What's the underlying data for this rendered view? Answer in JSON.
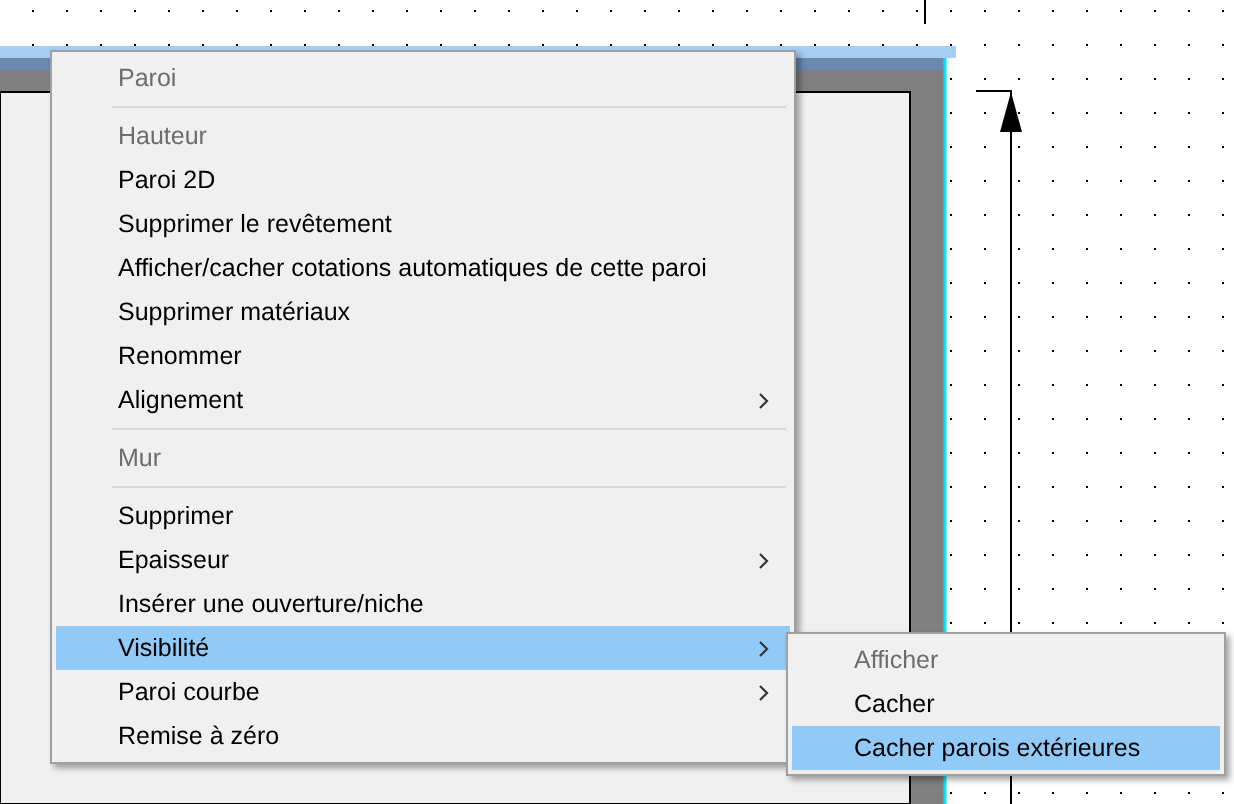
{
  "context_menu": {
    "items": [
      {
        "kind": "item",
        "label": "Paroi",
        "disabled": true,
        "submenu": false,
        "selected": false
      },
      {
        "kind": "separator"
      },
      {
        "kind": "item",
        "label": "Hauteur",
        "disabled": true,
        "submenu": false,
        "selected": false
      },
      {
        "kind": "item",
        "label": "Paroi 2D",
        "disabled": false,
        "submenu": false,
        "selected": false
      },
      {
        "kind": "item",
        "label": "Supprimer le revêtement",
        "disabled": false,
        "submenu": false,
        "selected": false
      },
      {
        "kind": "item",
        "label": "Afficher/cacher cotations automatiques de cette paroi",
        "disabled": false,
        "submenu": false,
        "selected": false
      },
      {
        "kind": "item",
        "label": "Supprimer matériaux",
        "disabled": false,
        "submenu": false,
        "selected": false
      },
      {
        "kind": "item",
        "label": "Renommer",
        "disabled": false,
        "submenu": false,
        "selected": false
      },
      {
        "kind": "item",
        "label": "Alignement",
        "disabled": false,
        "submenu": true,
        "selected": false
      },
      {
        "kind": "separator"
      },
      {
        "kind": "item",
        "label": "Mur",
        "disabled": true,
        "submenu": false,
        "selected": false
      },
      {
        "kind": "separator"
      },
      {
        "kind": "item",
        "label": "Supprimer",
        "disabled": false,
        "submenu": false,
        "selected": false
      },
      {
        "kind": "item",
        "label": "Epaisseur",
        "disabled": false,
        "submenu": true,
        "selected": false
      },
      {
        "kind": "item",
        "label": "Insérer une ouverture/niche",
        "disabled": false,
        "submenu": false,
        "selected": false
      },
      {
        "kind": "item",
        "label": "Visibilité",
        "disabled": false,
        "submenu": true,
        "selected": true
      },
      {
        "kind": "item",
        "label": "Paroi courbe",
        "disabled": false,
        "submenu": true,
        "selected": false
      },
      {
        "kind": "item",
        "label": "Remise à zéro",
        "disabled": false,
        "submenu": false,
        "selected": false
      }
    ]
  },
  "submenu": {
    "items": [
      {
        "label": "Afficher",
        "disabled": true,
        "selected": false
      },
      {
        "label": "Cacher",
        "disabled": false,
        "selected": false
      },
      {
        "label": "Cacher parois extérieures",
        "disabled": false,
        "selected": true
      }
    ]
  }
}
